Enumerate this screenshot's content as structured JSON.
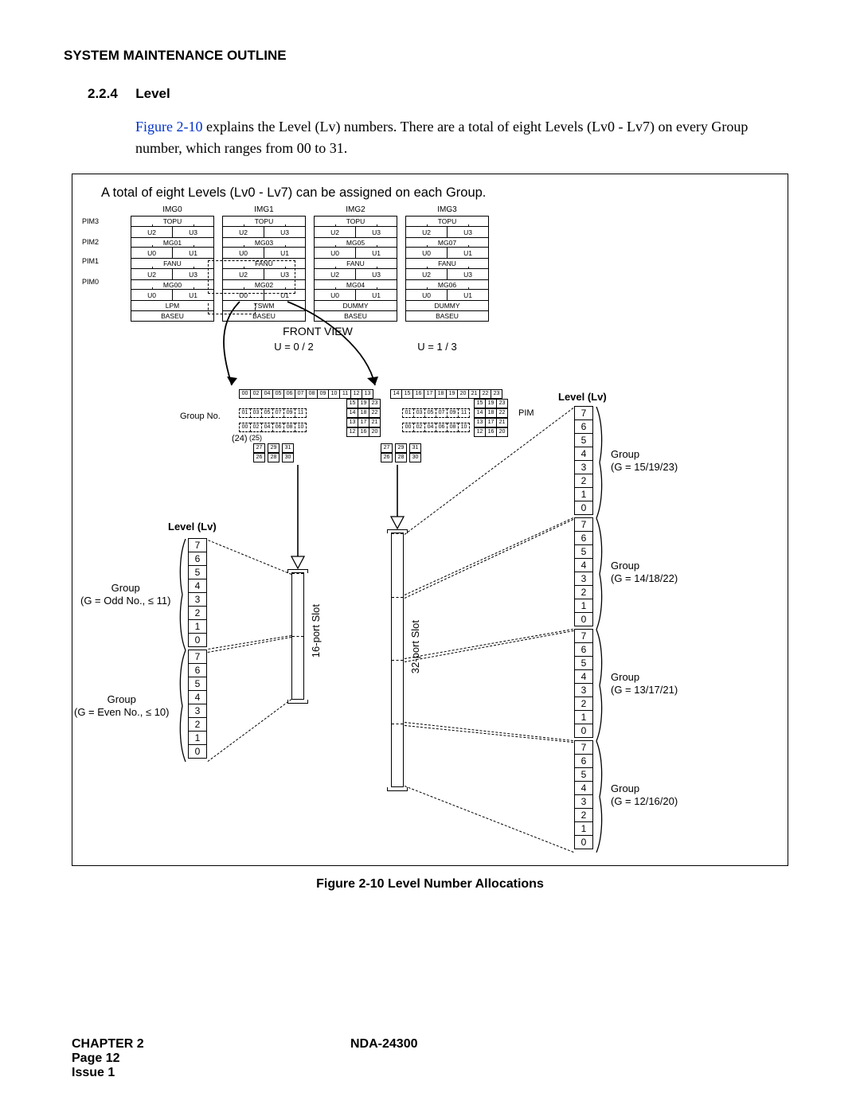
{
  "header": "SYSTEM MAINTENANCE OUTLINE",
  "section_num": "2.2.4",
  "section_title": "Level",
  "para_ref": "Figure 2-10",
  "para_rest": " explains the Level (Lv) numbers. There are a total of eight Levels (Lv0 - Lv7) on every Group number, which ranges from 00 to 31.",
  "fig_top": "A total of eight Levels (Lv0 - Lv7) can be assigned on each Group.",
  "img_labels": [
    "IMG0",
    "IMG1",
    "IMG2",
    "IMG3"
  ],
  "topu": "TOPU",
  "fanu": "FANU",
  "baseu": "BASEU",
  "lpm": "LPM",
  "tswm": "TSWM",
  "dummy": "DUMMY",
  "u0": "U0",
  "u1": "U1",
  "u2": "U2",
  "u3": "U3",
  "mg": [
    "MG01",
    "MG03",
    "MG05",
    "MG07",
    "MG00",
    "MG02",
    "MG04",
    "MG06"
  ],
  "pim_rows": [
    "PIM3",
    "PIM2",
    "PIM1",
    "PIM0"
  ],
  "front_view": "FRONT VIEW",
  "u_eq_l": "U = 0 / 2",
  "u_eq_r": "U = 1 / 3",
  "group_no": "Group No.",
  "paren_24": "(24)",
  "paren_25": "(25)",
  "pim_text": "PIM",
  "top_row_a": [
    "00",
    "02",
    "04",
    "05",
    "06",
    "07",
    "08",
    "09",
    "10",
    "11",
    "12",
    "13"
  ],
  "top_row_b": [
    "14",
    "15",
    "16",
    "17",
    "18",
    "19",
    "20",
    "21",
    "22",
    "23"
  ],
  "stack_a": [
    "15",
    "19",
    "23",
    "14",
    "18",
    "22",
    "13",
    "17",
    "21",
    "12",
    "16",
    "20"
  ],
  "row_b1": [
    "01",
    "03",
    "05",
    "07",
    "09",
    "11"
  ],
  "row_b2": [
    "00",
    "02",
    "04",
    "06",
    "08",
    "10"
  ],
  "bot_nums_a": [
    "27",
    "29",
    "31",
    "26",
    "28",
    "30"
  ],
  "bot_nums_b": [
    "27",
    "29",
    "31",
    "26",
    "28",
    "30"
  ],
  "level_title": "Level (Lv)",
  "lv_nums": [
    "7",
    "6",
    "5",
    "4",
    "3",
    "2",
    "1",
    "0"
  ],
  "left_grp1_a": "Group",
  "left_grp1_b": "(G = Odd No., ≤ 11)",
  "left_grp2_a": "Group",
  "left_grp2_b": "(G = Even No., ≤ 10)",
  "slot16": "16-port Slot",
  "slot32": "32-port Slot",
  "right_grp": [
    {
      "a": "Group",
      "b": "(G = 15/19/23)"
    },
    {
      "a": "Group",
      "b": "(G = 14/18/22)"
    },
    {
      "a": "Group",
      "b": "(G = 13/17/21)"
    },
    {
      "a": "Group",
      "b": "(G = 12/16/20)"
    }
  ],
  "fig_caption": "Figure 2-10   Level Number Allocations",
  "footer_chapter": "CHAPTER 2",
  "footer_page": "Page 12",
  "footer_issue": "Issue 1",
  "footer_doc": "NDA-24300"
}
